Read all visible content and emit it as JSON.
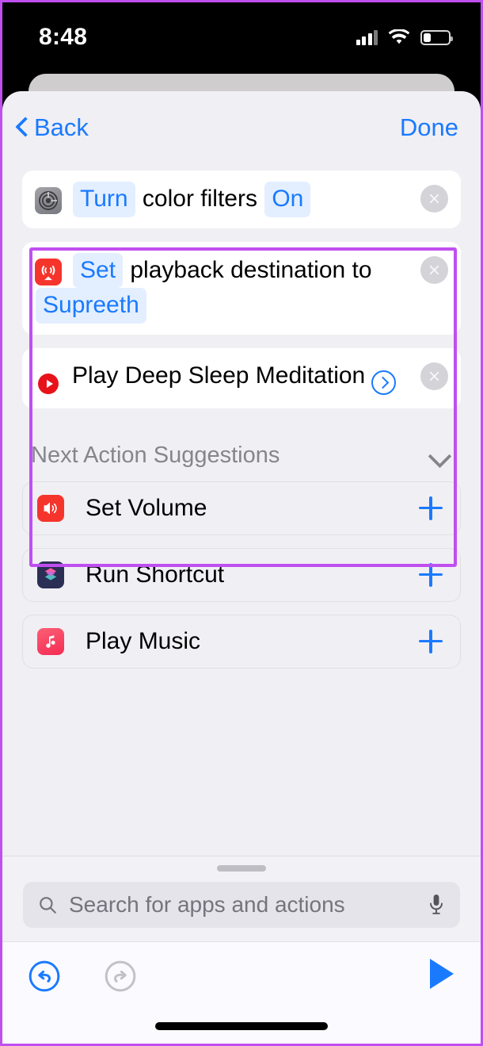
{
  "status_bar": {
    "time": "8:48",
    "signal_icon": "cellular-bars-icon",
    "wifi_icon": "wifi-icon",
    "battery_icon": "battery-icon",
    "battery_level_percent": 30
  },
  "nav": {
    "back_label": "Back",
    "done_label": "Done",
    "back_icon": "chevron-left-icon"
  },
  "colors": {
    "accent_blue": "#1a7aff",
    "pill_background": "#e3efff",
    "highlight_purple": "#c04ff0",
    "sheet_background": "#f0eff4",
    "card_background": "#ffffff",
    "muted_gray": "#86858c"
  },
  "actions": [
    {
      "icon": "accessibility-settings-icon",
      "icon_color": "#8e8e93",
      "tokens": [
        {
          "type": "pill",
          "text": "Turn"
        },
        {
          "type": "plain",
          "text": "color filters"
        },
        {
          "type": "pill",
          "text": "On"
        }
      ],
      "delete_icon": "close-circle-icon"
    },
    {
      "icon": "airplay-icon",
      "icon_color": "#f5352c",
      "tokens": [
        {
          "type": "pill",
          "text": "Set"
        },
        {
          "type": "plain",
          "text": "playback destination to"
        },
        {
          "type": "pill",
          "text": "Supreeth"
        }
      ],
      "delete_icon": "close-circle-icon"
    },
    {
      "icon": "youtube-music-icon",
      "icon_color": "#e8131a",
      "tokens": [
        {
          "type": "plain",
          "text": "Play Deep Sleep Meditation"
        },
        {
          "type": "chevron",
          "text": ""
        }
      ],
      "delete_icon": "close-circle-icon"
    }
  ],
  "suggestions": {
    "header": "Next Action Suggestions",
    "collapse_icon": "chevron-down-icon",
    "items": [
      {
        "label": "Set Volume",
        "icon": "speaker-volume-icon",
        "add_icon": "plus-icon"
      },
      {
        "label": "Run Shortcut",
        "icon": "shortcuts-app-icon",
        "add_icon": "plus-icon"
      },
      {
        "label": "Play Music",
        "icon": "music-note-icon",
        "add_icon": "plus-icon"
      }
    ]
  },
  "search": {
    "placeholder": "Search for apps and actions",
    "value": "",
    "search_icon": "search-icon",
    "mic_icon": "microphone-icon",
    "grabber": "drag-handle"
  },
  "toolbar": {
    "undo_icon": "undo-icon",
    "undo_enabled": true,
    "redo_icon": "redo-icon",
    "redo_enabled": false,
    "run_icon": "play-icon"
  }
}
